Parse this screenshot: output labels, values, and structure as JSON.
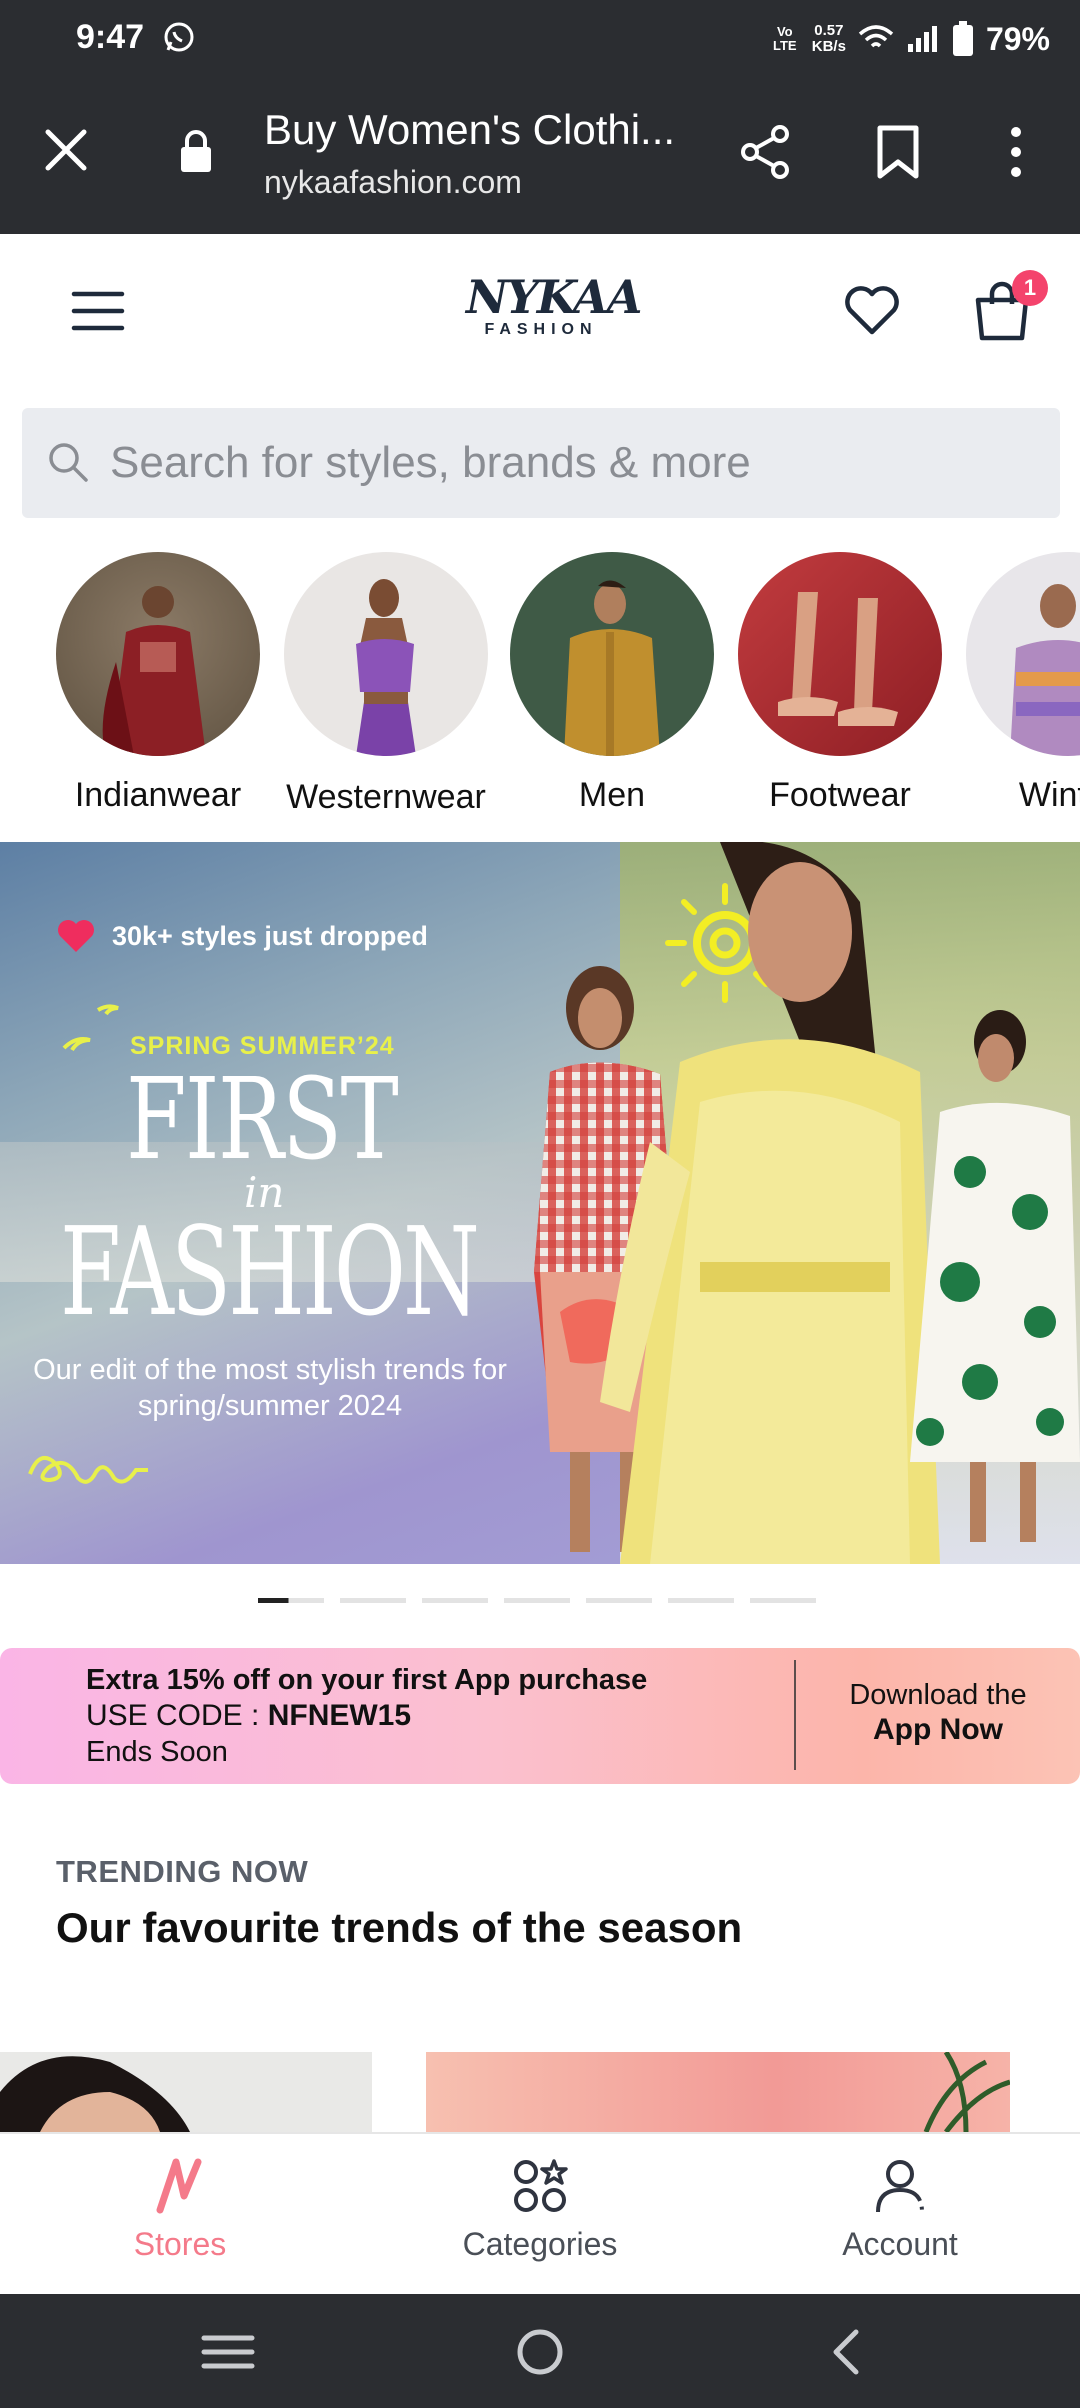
{
  "status_bar": {
    "time": "9:47",
    "volte": "Vo LTE",
    "speed_value": "0.57",
    "speed_unit": "KB/s",
    "battery": "79%"
  },
  "browser": {
    "title": "Buy Women's Clothi...",
    "url": "nykaafashion.com"
  },
  "header": {
    "logo_main": "NYKAA",
    "logo_sub": "FASHION",
    "cart_count": "1"
  },
  "search": {
    "placeholder": "Search for styles, brands & more"
  },
  "categories": [
    {
      "label": "Indianwear"
    },
    {
      "label": "Westernwear"
    },
    {
      "label": "Men"
    },
    {
      "label": "Footwear"
    },
    {
      "label": "Winter"
    }
  ],
  "hero": {
    "tagline": "30k+ styles just dropped",
    "season": "SPRING SUMMER’24",
    "headline_1": "FIRST",
    "headline_in": "in",
    "headline_2": "FASHION",
    "subtitle": "Our edit of the most stylish trends for spring/summer 2024"
  },
  "carousel": {
    "total": 7,
    "active_index": 0
  },
  "promo": {
    "line1": "Extra 15% off on your first App purchase",
    "code_prefix": "USE CODE : ",
    "code": "NFNEW15",
    "line3": "Ends Soon",
    "cta_line1": "Download the",
    "cta_line2": "App Now"
  },
  "trending": {
    "kicker": "TRENDING NOW",
    "title": "Our favourite trends of the season"
  },
  "bottom_nav": [
    {
      "label": "Stores",
      "icon": "nykaa-n-icon",
      "active": true
    },
    {
      "label": "Categories",
      "icon": "categories-icon",
      "active": false
    },
    {
      "label": "Account",
      "icon": "account-icon",
      "active": false
    }
  ],
  "colors": {
    "accent_pink": "#f47a8a",
    "badge_pink": "#f4436c",
    "dark_chrome": "#2b2d31",
    "logo_navy": "#1e2a3b"
  }
}
